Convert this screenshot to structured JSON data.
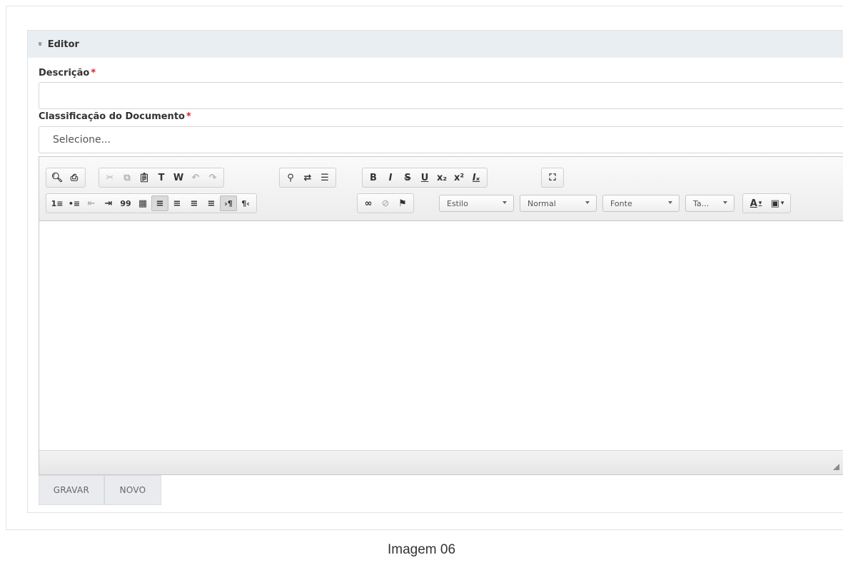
{
  "panel": {
    "title": "Editor",
    "collapse_glyph": "»"
  },
  "form": {
    "descricao_label": "Descrição",
    "classificacao_label": "Classificação do Documento",
    "required_mark": "*",
    "descricao_value": "",
    "select_value": "Selecione..."
  },
  "toolbar": {
    "row1": [
      {
        "icon": "preview-icon",
        "glyph": "🔍︎"
      },
      {
        "icon": "print-icon",
        "glyph": "⎙"
      },
      {
        "icon": "cut-icon",
        "glyph": "✂"
      },
      {
        "icon": "copy-icon",
        "glyph": "⧉"
      },
      {
        "icon": "paste-icon",
        "glyph": "📋︎"
      },
      {
        "icon": "paste-text-icon",
        "glyph": "T"
      },
      {
        "icon": "paste-word-icon",
        "glyph": "W"
      },
      {
        "icon": "undo-icon",
        "glyph": "↶"
      },
      {
        "icon": "redo-icon",
        "glyph": "↷"
      },
      {
        "icon": "find-icon",
        "glyph": "⚲"
      },
      {
        "icon": "replace-icon",
        "glyph": "⇄"
      },
      {
        "icon": "page-break-icon",
        "glyph": "☰"
      },
      {
        "icon": "bold-icon",
        "glyph": "B"
      },
      {
        "icon": "italic-icon",
        "glyph": "I"
      },
      {
        "icon": "strike-icon",
        "glyph": "S"
      },
      {
        "icon": "underline-icon",
        "glyph": "U"
      },
      {
        "icon": "subscript-icon",
        "glyph": "x₂"
      },
      {
        "icon": "superscript-icon",
        "glyph": "x²"
      },
      {
        "icon": "remove-format-icon",
        "glyph": "Iₓ"
      },
      {
        "icon": "maximize-icon",
        "glyph": "⛶"
      }
    ],
    "row2": [
      {
        "icon": "numbered-list-icon",
        "glyph": "1≡"
      },
      {
        "icon": "bulleted-list-icon",
        "glyph": "•≡"
      },
      {
        "icon": "outdent-icon",
        "glyph": "⇤"
      },
      {
        "icon": "indent-icon",
        "glyph": "⇥"
      },
      {
        "icon": "blockquote-icon",
        "glyph": "99"
      },
      {
        "icon": "div-container-icon",
        "glyph": "▦"
      },
      {
        "icon": "align-left-icon",
        "glyph": "≡"
      },
      {
        "icon": "align-center-icon",
        "glyph": "≡"
      },
      {
        "icon": "align-right-icon",
        "glyph": "≡"
      },
      {
        "icon": "justify-icon",
        "glyph": "≡"
      },
      {
        "icon": "ltr-icon",
        "glyph": "›¶"
      },
      {
        "icon": "rtl-icon",
        "glyph": "¶‹"
      },
      {
        "icon": "link-icon",
        "glyph": "∞"
      },
      {
        "icon": "unlink-icon",
        "glyph": "⊘"
      },
      {
        "icon": "anchor-flag-icon",
        "glyph": "⚑"
      },
      {
        "icon": "text-color-icon",
        "glyph": "A"
      },
      {
        "icon": "bg-color-icon",
        "glyph": "▣"
      }
    ],
    "combos": {
      "estilo": "Estilo",
      "normal": "Normal",
      "fonte": "Fonte",
      "tamanho": "Ta..."
    },
    "dropdown_glyph": "▾"
  },
  "buttons": {
    "gravar": "GRAVAR",
    "novo": "NOVO"
  },
  "caption": "Imagem 06"
}
